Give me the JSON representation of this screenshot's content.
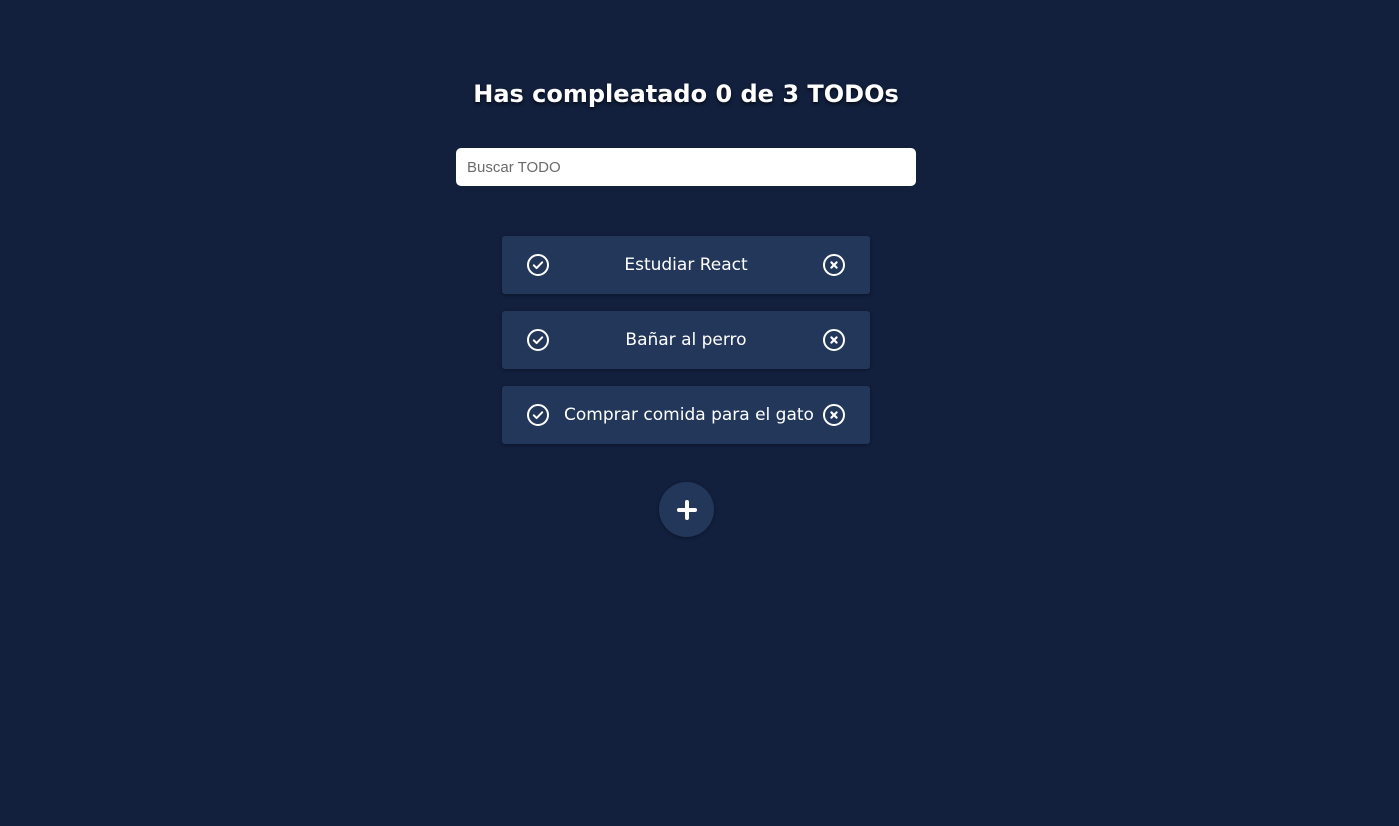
{
  "header": {
    "counter_text": "Has compleatado 0 de 3 TODOs"
  },
  "search": {
    "placeholder": "Buscar TODO",
    "value": ""
  },
  "todos": [
    {
      "text": "Estudiar React",
      "completed": false,
      "complete_icon": "check-circle-icon",
      "delete_icon": "x-circle-icon"
    },
    {
      "text": "Bañar al perro",
      "completed": false,
      "complete_icon": "check-circle-icon",
      "delete_icon": "x-circle-icon"
    },
    {
      "text": "Comprar comida para el gato",
      "completed": false,
      "complete_icon": "check-circle-icon",
      "delete_icon": "x-circle-icon"
    }
  ],
  "create_button": {
    "icon": "plus-icon"
  },
  "colors": {
    "background": "#121f3d",
    "card": "#23375b",
    "text": "#ffffff",
    "input_background": "#ffffff"
  }
}
